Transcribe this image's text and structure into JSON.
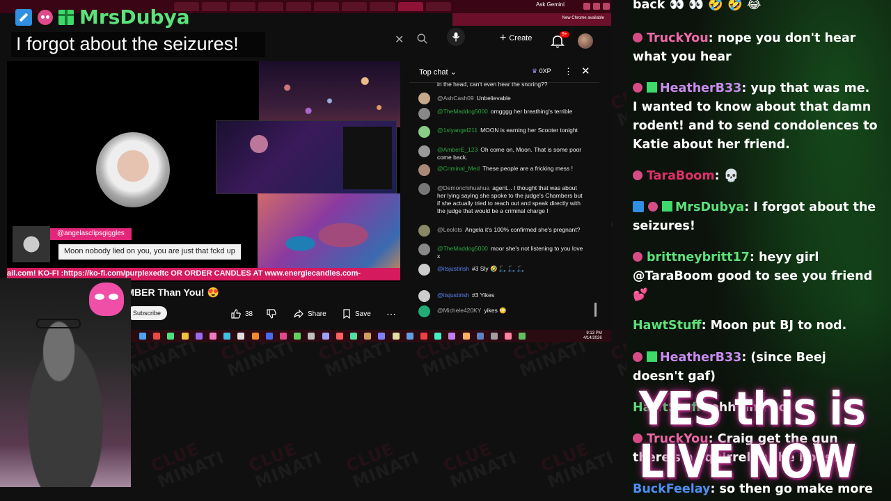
{
  "overlay": {
    "username": "MrsDubya",
    "title": "I forgot about the seizures!"
  },
  "browser": {
    "tab_title": "Ask Gemini",
    "update_text": "New Chrome available"
  },
  "youtube": {
    "create_label": "Create",
    "notif_count": "9+",
    "video_title": "EMBER Than You! 😍",
    "subscribe_label": "Subscribe",
    "like_count": "38",
    "share_label": "Share",
    "save_label": "Save",
    "ticker": "ail.com! KO-FI :https://ko-fi.com/purplexedtc OR ORDER CANDLES AT www.energiecandles.com-",
    "alert_name": "@angelasclipsgiggles",
    "alert_message": "Moon nobody lied on you, you are just that fckd up"
  },
  "live_chat": {
    "header": "Top chat",
    "points": "0XP",
    "messages": [
      {
        "author": "",
        "text": "in the head, can't even hear the snoring??",
        "color": "#9aa"
      },
      {
        "author": "@AshCash09",
        "text": "Unbelievable",
        "color": "#c9a98c"
      },
      {
        "author": "@TheMaddog5000",
        "text": "omgggg her breathing's terrible",
        "color": "#888"
      },
      {
        "author": "@1slyangel211",
        "text": "MOON is earning her Scooter tonight",
        "color": "#8c8"
      },
      {
        "author": "@AmberE_123",
        "text": "Oh come on, Moon. That is some poor come back.",
        "color": "#999"
      },
      {
        "author": "@Criminal_Med",
        "text": "These people are a fricking mess !",
        "color": "#a87"
      },
      {
        "author": "@Demonchihuahua",
        "text": "agent... I thought that was about her lying saying she spoke to the judge's Chambers but if she actually tried to reach out and speak directly with the judge that would be a criminal charge l",
        "color": "#777"
      },
      {
        "author": "@Leolots",
        "text": "Angela it's 100% confirmed she's pregnant?",
        "color": "#886"
      },
      {
        "author": "@TheMaddog5000",
        "text": "moor she's not listening to you love x",
        "color": "#888"
      },
      {
        "author": "@itsjustirish",
        "text": "#3  Sly 🤣 🛴 🛴 🛴",
        "color": "#ccc"
      },
      {
        "author": "@itsjustirish",
        "text": "#3  Yikes",
        "color": "#ccc"
      },
      {
        "author": "@Michele420KY",
        "text": "yikes 😳",
        "color": "#2a7"
      }
    ]
  },
  "taskbar": {
    "time": "9:13 PM",
    "date": "4/14/2026"
  },
  "side_chat": [
    {
      "name": "",
      "text": "back 👀 👀 🤣 🤣 😂",
      "name_color": "#ffffff"
    },
    {
      "name": "TruckYou",
      "text": ": nope you don't hear what you hear",
      "name_color": "#f06aa8"
    },
    {
      "name": "HeatherB33",
      "text": ": yup that was me. I wanted to know about that damn rodent! and to send condolences to Katie about her friend.",
      "name_color": "#c98cf0"
    },
    {
      "name": "TaraBoom",
      "text": ": 💀",
      "name_color": "#e0306a"
    },
    {
      "name": "MrsDubya",
      "text": ": I forgot about the seizures!",
      "name_color": "#5de17a"
    },
    {
      "name": "brittneybritt17",
      "text": ": heyy girl @TaraBoom good to see you friend 💕",
      "name_color": "#5de17a"
    },
    {
      "name": "HawtStuff",
      "text": ": Moon put BJ to nod.",
      "name_color": "#5de17a"
    },
    {
      "name": "HeatherB33",
      "text": ": (since Beej doesn't gaf)",
      "name_color": "#c98cf0"
    },
    {
      "name": "HawtStuff",
      "text": ": ohh uhh yo",
      "name_color": "#5de17a"
    },
    {
      "name": "TruckYou",
      "text": ": Craig get the gun there's a squirrel in the house",
      "name_color": "#f06aa8"
    },
    {
      "name": "BuckFeelay",
      "text": ": so then go make more",
      "name_color": "#4f8ef0"
    }
  ],
  "banner": {
    "line1": "YES this is",
    "line2": "LIVE NOW"
  },
  "watermark": {
    "word1": "CLUE",
    "word2": "MINATI"
  }
}
